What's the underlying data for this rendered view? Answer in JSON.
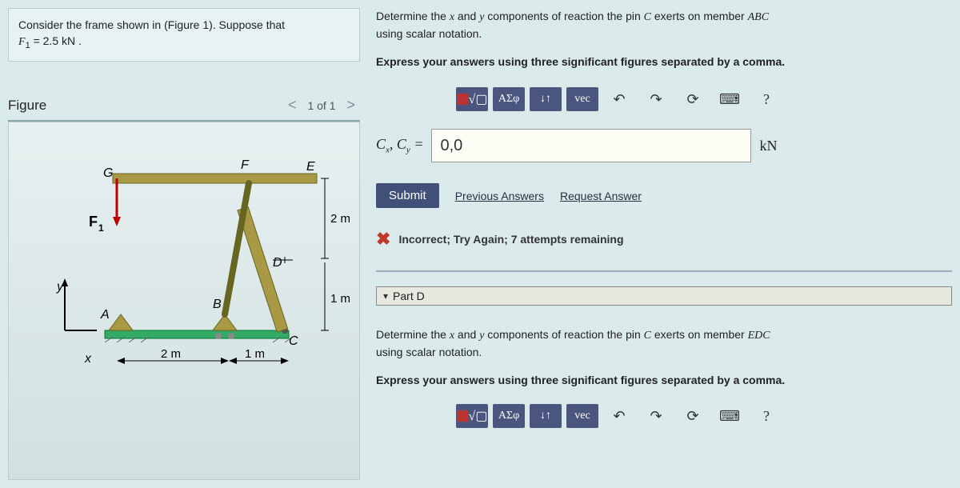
{
  "problem_text_1": "Consider the frame shown in (Figure 1). Suppose that",
  "problem_text_2": "F₁ = 2.5 kN .",
  "figure": {
    "title": "Figure",
    "pager": "1 of 1",
    "labels": {
      "G": "G",
      "E": "E",
      "F": "F",
      "D": "D",
      "B": "B",
      "A": "A",
      "C": "C",
      "F1": "F₁",
      "x": "x",
      "y": "y",
      "dim2m": "2 m",
      "dim2m_h": "2 m",
      "dim1m": "1 m",
      "dim1m_h": "1 m"
    }
  },
  "partC": {
    "instruction_pre": "Determine the ",
    "instruction_mid": " and ",
    "instruction_post": " components of reaction the pin ",
    "instruction_end": " exerts on member ",
    "member": "ABC",
    "scalar_line": "using scalar notation.",
    "express": "Express your answers using three significant figures separated by a comma.",
    "label": "Cₓ, Cᵧ =",
    "value": "0,0",
    "unit": "kN",
    "submit": "Submit",
    "previous": "Previous Answers",
    "request": "Request Answer",
    "feedback": "Incorrect; Try Again; 7 attempts remaining"
  },
  "toolbar": {
    "chem": "",
    "radical": "√▢",
    "greek": "ΑΣφ",
    "arrows": "↓↑",
    "vec": "vec",
    "undo": "↶",
    "redo": "↷",
    "reset": "⟳",
    "keyboard": "⌨",
    "help": "?"
  },
  "partD": {
    "title": "Part D",
    "instruction_pre": "Determine the ",
    "instruction_mid": " and ",
    "instruction_post": " components of reaction the pin ",
    "instruction_end": " exerts on member ",
    "member": "EDC",
    "scalar_line": "using scalar notation.",
    "express": "Express your answers using three significant figures separated by a comma."
  },
  "chart_data": {
    "type": "diagram",
    "description": "Structural frame with members ABC (horizontal base), EDC (angled), and GF (horizontal top). Force F1 applied downward at G.",
    "points": {
      "A": [
        0,
        0
      ],
      "B": [
        2,
        0
      ],
      "C": [
        3,
        0
      ],
      "D": [
        3,
        1
      ],
      "E": [
        3,
        3
      ],
      "G": [
        0,
        3
      ],
      "F": [
        2.5,
        3
      ]
    },
    "dimensions": {
      "A_to_B": "2 m",
      "B_to_C": "1 m",
      "C_to_D": "1 m",
      "D_to_E": "2 m"
    },
    "force": {
      "name": "F1",
      "value": 2.5,
      "unit": "kN",
      "location": "G",
      "direction": "down"
    }
  }
}
